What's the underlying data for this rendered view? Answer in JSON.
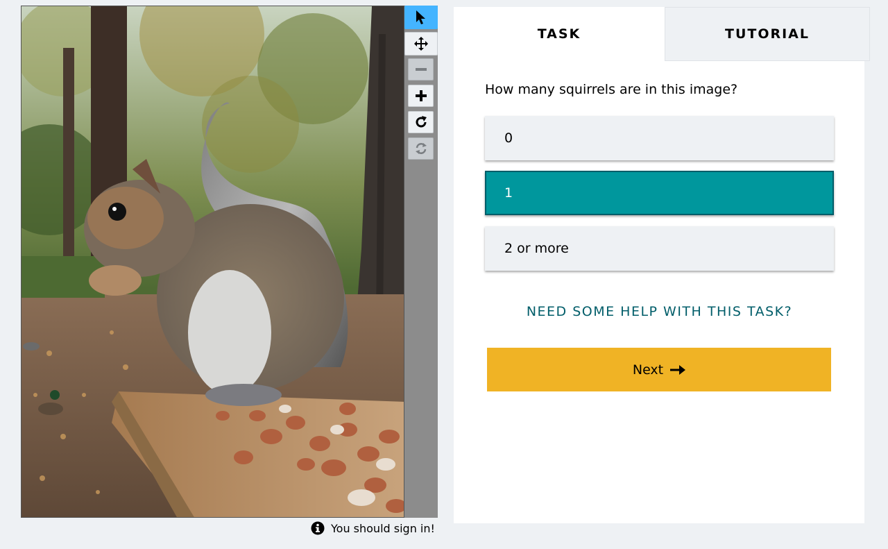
{
  "subject_viewer": {
    "image_description_icon": "squirrel-photo",
    "tools": [
      {
        "icon": "pointer-icon",
        "state": "active"
      },
      {
        "icon": "move-icon",
        "state": "normal"
      },
      {
        "icon": "zoom-out-icon",
        "state": "disabled"
      },
      {
        "icon": "zoom-in-icon",
        "state": "normal"
      },
      {
        "icon": "rotate-icon",
        "state": "normal"
      },
      {
        "icon": "reset-icon",
        "state": "disabled"
      }
    ],
    "signin_notice": "You should sign in!"
  },
  "tabs": {
    "task": "TASK",
    "tutorial": "TUTORIAL"
  },
  "task": {
    "question": "How many squirrels are in this image?",
    "answers": [
      "0",
      "1",
      "2 or more"
    ],
    "selected_answer": "1",
    "help_link": "NEED SOME HELP WITH THIS TASK?",
    "next_label": "Next"
  },
  "colors": {
    "selected_answer_bg": "#00979d",
    "next_button_bg": "#f0b325",
    "help_link_color": "#005d69",
    "active_tool_bg": "#44b4ff"
  }
}
